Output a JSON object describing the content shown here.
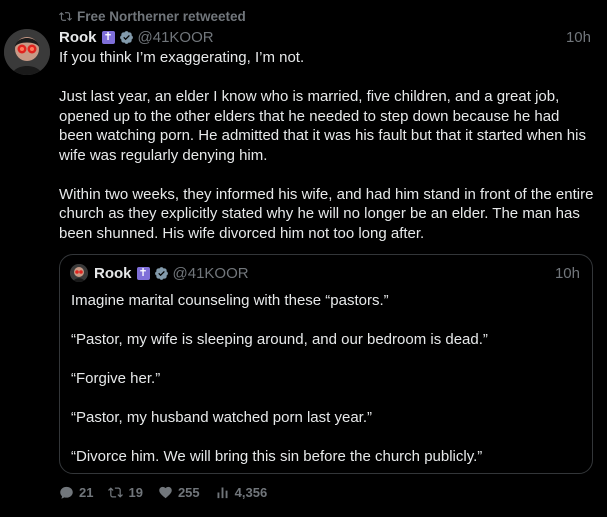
{
  "retweet": {
    "text": "Free Northerner retweeted",
    "icon": "retweet-icon"
  },
  "tweet": {
    "name": "Rook",
    "badge": "✝",
    "handle": "@41KOOR",
    "time": "10h",
    "paragraphs": [
      "If you think I’m exaggerating, I’m not.",
      "Just last year, an elder I know who is married, five children, and a great job, opened up to the other elders that he needed to step down because he had been watching porn. He admitted that it was his fault but that it started when his wife was regularly denying him.",
      "Within two weeks, they informed his wife, and had him stand in front of the entire church as they explicitly stated why he will no longer be an elder. The man has been shunned. His wife divorced him not too long after."
    ]
  },
  "quote": {
    "name": "Rook",
    "badge": "✝",
    "handle": "@41KOOR",
    "time": "10h",
    "paragraphs": [
      "Imagine marital counseling with these “pastors.”",
      "“Pastor, my wife is sleeping around, and our bedroom is dead.”",
      "“Forgive her.”",
      "“Pastor, my husband watched porn last year.”",
      "“Divorce him. We will bring this sin before the church publicly.”"
    ]
  },
  "actions": {
    "replies": "21",
    "retweets": "19",
    "likes": "255",
    "views": "4,356"
  },
  "colors": {
    "background": "#000000",
    "text": "#e7e9ea",
    "muted": "#71767b",
    "border": "#333639",
    "badge": "#7f6fd9",
    "verified": "#829aab"
  }
}
